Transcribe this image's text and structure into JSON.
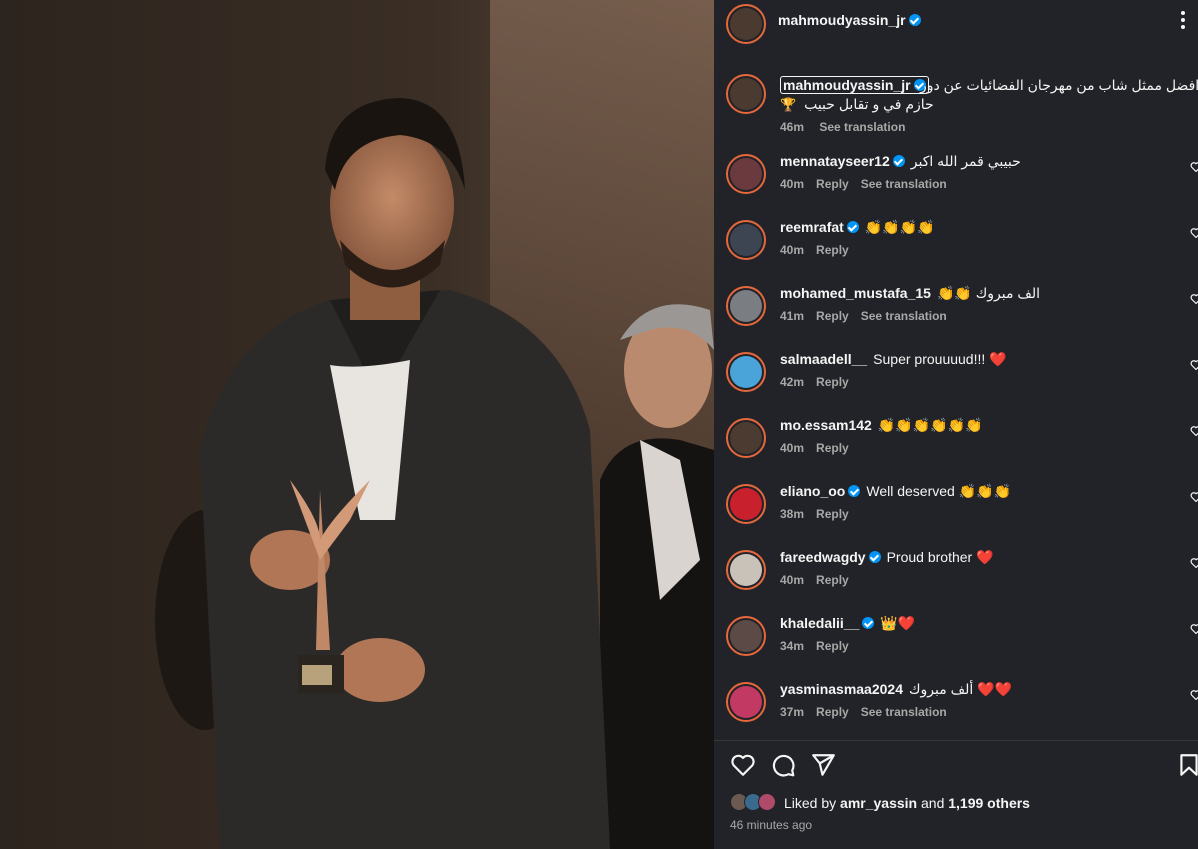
{
  "post": {
    "author": "mahmoudyassin_jr",
    "caption_line1": "افضل ممثل شاب من مهرجان الفضائيات عن دور",
    "caption_line2": "حازم في و تقابل حبيب",
    "caption_trophy": "🏆",
    "caption_time": "46m",
    "see_translation": "See translation"
  },
  "comments": [
    {
      "user": "mennatayseer12",
      "verified": true,
      "text": "حبيبي قمر الله اكبر",
      "time": "40m",
      "reply": "Reply",
      "translation": "See translation",
      "avatar_color": "#6b3a3e"
    },
    {
      "user": "reemrafat",
      "verified": true,
      "text": "👏👏👏👏",
      "time": "40m",
      "reply": "Reply",
      "translation": "",
      "avatar_color": "#3e4552"
    },
    {
      "user": "mohamed_mustafa_15",
      "verified": false,
      "text": "👏👏 الف مبروك",
      "time": "41m",
      "reply": "Reply",
      "translation": "See translation",
      "avatar_color": "#7a7d82"
    },
    {
      "user": "salmaadell__",
      "verified": false,
      "text": "Super prouuuud!!! ❤️",
      "time": "42m",
      "reply": "Reply",
      "translation": "",
      "avatar_color": "#4aa3d9"
    },
    {
      "user": "mo.essam142",
      "verified": false,
      "text": "👏👏👏👏👏👏",
      "time": "40m",
      "reply": "Reply",
      "translation": "",
      "avatar_color": "#4b3b30"
    },
    {
      "user": "eliano_oo",
      "verified": true,
      "text": "Well deserved 👏👏👏",
      "time": "38m",
      "reply": "Reply",
      "translation": "",
      "avatar_color": "#c8202c"
    },
    {
      "user": "fareedwagdy",
      "verified": true,
      "text": "Proud brother ❤️",
      "time": "40m",
      "reply": "Reply",
      "translation": "",
      "avatar_color": "#c9c2b8"
    },
    {
      "user": "khaledalii__",
      "verified": true,
      "text": "👑❤️",
      "time": "34m",
      "reply": "Reply",
      "translation": "",
      "avatar_color": "#5b4a46"
    },
    {
      "user": "yasminasmaa2024",
      "verified": false,
      "text": "ألف مبروك ❤️❤️",
      "time": "37m",
      "reply": "Reply",
      "translation": "See translation",
      "avatar_color": "#c23a63"
    }
  ],
  "likes": {
    "prefix": "Liked by",
    "user": "amr_yassin",
    "joiner": "and",
    "count_text": "1,199 others"
  },
  "posted_ago": "46 minutes ago",
  "icons": [
    "heart-icon",
    "comment-icon",
    "share-icon",
    "bookmark-icon",
    "more-icon",
    "verified-icon"
  ]
}
